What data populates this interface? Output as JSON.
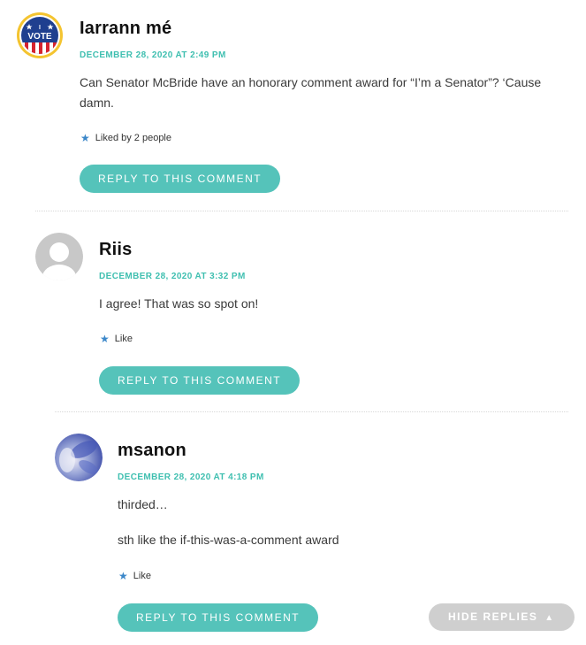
{
  "comments": [
    {
      "author": "Iarrann mé",
      "date": "DECEMBER 28, 2020 AT 2:49 PM",
      "text": "Can Senator McBride have an honorary comment award for “I’m a Senator”? ‘Cause damn.",
      "likes": "Liked by 2 people",
      "reply_label": "REPLY TO THIS COMMENT",
      "avatar_badge_text": "I VOTE"
    },
    {
      "author": "Riis",
      "date": "DECEMBER 28, 2020 AT 3:32 PM",
      "text": "I agree! That was so spot on!",
      "likes": "Like",
      "reply_label": "REPLY TO THIS COMMENT"
    },
    {
      "author": "msanon",
      "date": "DECEMBER 28, 2020 AT 4:18 PM",
      "paragraphs": [
        "thirded…",
        "sth like the if-this-was-a-comment award"
      ],
      "likes": "Like",
      "reply_label": "REPLY TO THIS COMMENT"
    }
  ],
  "hide_replies": {
    "label": "HIDE REPLIES",
    "icon": "triangle-up-icon"
  },
  "colors": {
    "accent": "#55c3ba",
    "date": "#3fbfb0",
    "star": "#3b87c9",
    "hide_button": "#cfcfcf"
  }
}
